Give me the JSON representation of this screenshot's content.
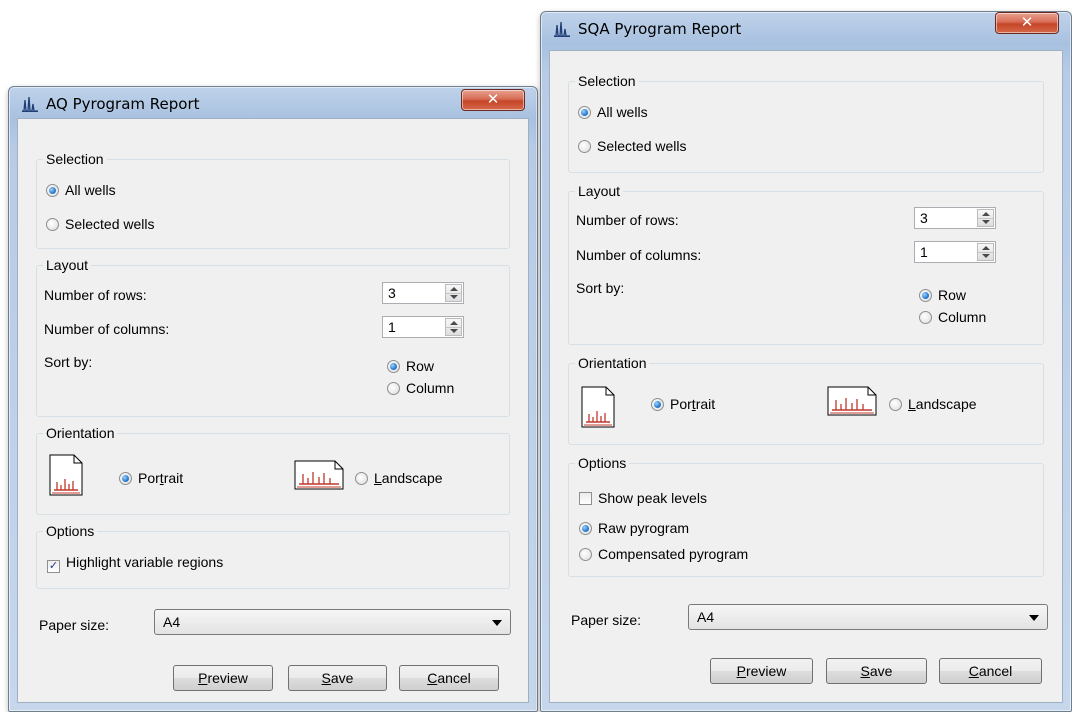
{
  "aq": {
    "title": "AQ Pyrogram Report",
    "close_glyph": "✕",
    "selection": {
      "label": "Selection",
      "all_wells": "All wells",
      "selected_wells": "Selected wells",
      "selected": "all_wells"
    },
    "layout": {
      "label": "Layout",
      "rows_label": "Number of rows:",
      "rows_value": "3",
      "columns_label": "Number of columns:",
      "columns_value": "1",
      "sort_label": "Sort by:",
      "sort_row": "Row",
      "sort_column": "Column",
      "sort_selected": "row"
    },
    "orientation": {
      "label": "Orientation",
      "portrait_prefix": "Por",
      "portrait_u": "t",
      "portrait_suffix": "rait",
      "landscape_u": "L",
      "landscape_suffix": "andscape",
      "selected": "portrait"
    },
    "options": {
      "label": "Options",
      "highlight": "Highlight variable regions",
      "highlight_checked": true
    },
    "paper": {
      "label": "Paper size:",
      "value": "A4"
    },
    "buttons": {
      "preview_u": "P",
      "preview_rest": "review",
      "save_u": "S",
      "save_rest": "ave",
      "cancel_u": "C",
      "cancel_rest": "ancel"
    }
  },
  "sqa": {
    "title": "SQA Pyrogram Report",
    "close_glyph": "✕",
    "selection": {
      "label": "Selection",
      "all_wells": "All wells",
      "selected_wells": "Selected wells",
      "selected": "all_wells"
    },
    "layout": {
      "label": "Layout",
      "rows_label": "Number of rows:",
      "rows_value": "3",
      "columns_label": "Number of columns:",
      "columns_value": "1",
      "sort_label": "Sort by:",
      "sort_row": "Row",
      "sort_column": "Column",
      "sort_selected": "row"
    },
    "orientation": {
      "label": "Orientation",
      "portrait_prefix": "Por",
      "portrait_u": "t",
      "portrait_suffix": "rait",
      "landscape_u": "L",
      "landscape_suffix": "andscape",
      "selected": "portrait"
    },
    "options": {
      "label": "Options",
      "show_peak": "Show peak levels",
      "show_peak_checked": false,
      "raw": "Raw pyrogram",
      "compensated": "Compensated pyrogram",
      "pyrogram_selected": "raw"
    },
    "paper": {
      "label": "Paper size:",
      "value": "A4"
    },
    "buttons": {
      "preview_u": "P",
      "preview_rest": "review",
      "save_u": "S",
      "save_rest": "ave",
      "cancel_u": "C",
      "cancel_rest": "ancel"
    }
  },
  "colors": {
    "page_bar_red": "#c0392b",
    "client_bg": "#f0f0f0",
    "title_glass": "#b7cbe5"
  }
}
